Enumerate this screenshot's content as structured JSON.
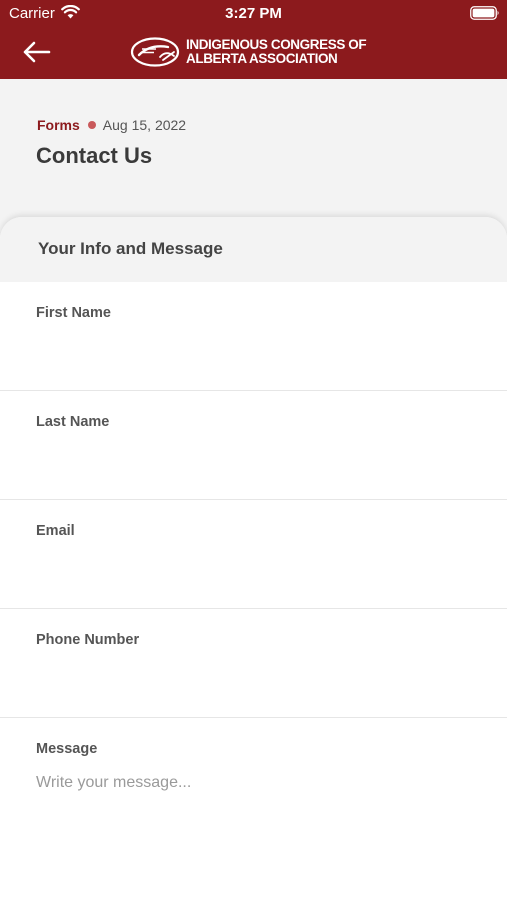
{
  "status_bar": {
    "carrier": "Carrier",
    "time": "3:27 PM"
  },
  "header": {
    "logo_line1": "Indigenous Congress of",
    "logo_line2": "Alberta Association",
    "brand_color": "#8c1a1d"
  },
  "page": {
    "category": "Forms",
    "date": "Aug 15, 2022",
    "title": "Contact Us"
  },
  "form": {
    "section_title": "Your Info and Message",
    "fields": [
      {
        "label": "First Name",
        "value": "",
        "placeholder": ""
      },
      {
        "label": "Last Name",
        "value": "",
        "placeholder": ""
      },
      {
        "label": "Email",
        "value": "",
        "placeholder": ""
      },
      {
        "label": "Phone Number",
        "value": "",
        "placeholder": ""
      },
      {
        "label": "Message",
        "value": "",
        "placeholder": "Write your message..."
      }
    ]
  }
}
